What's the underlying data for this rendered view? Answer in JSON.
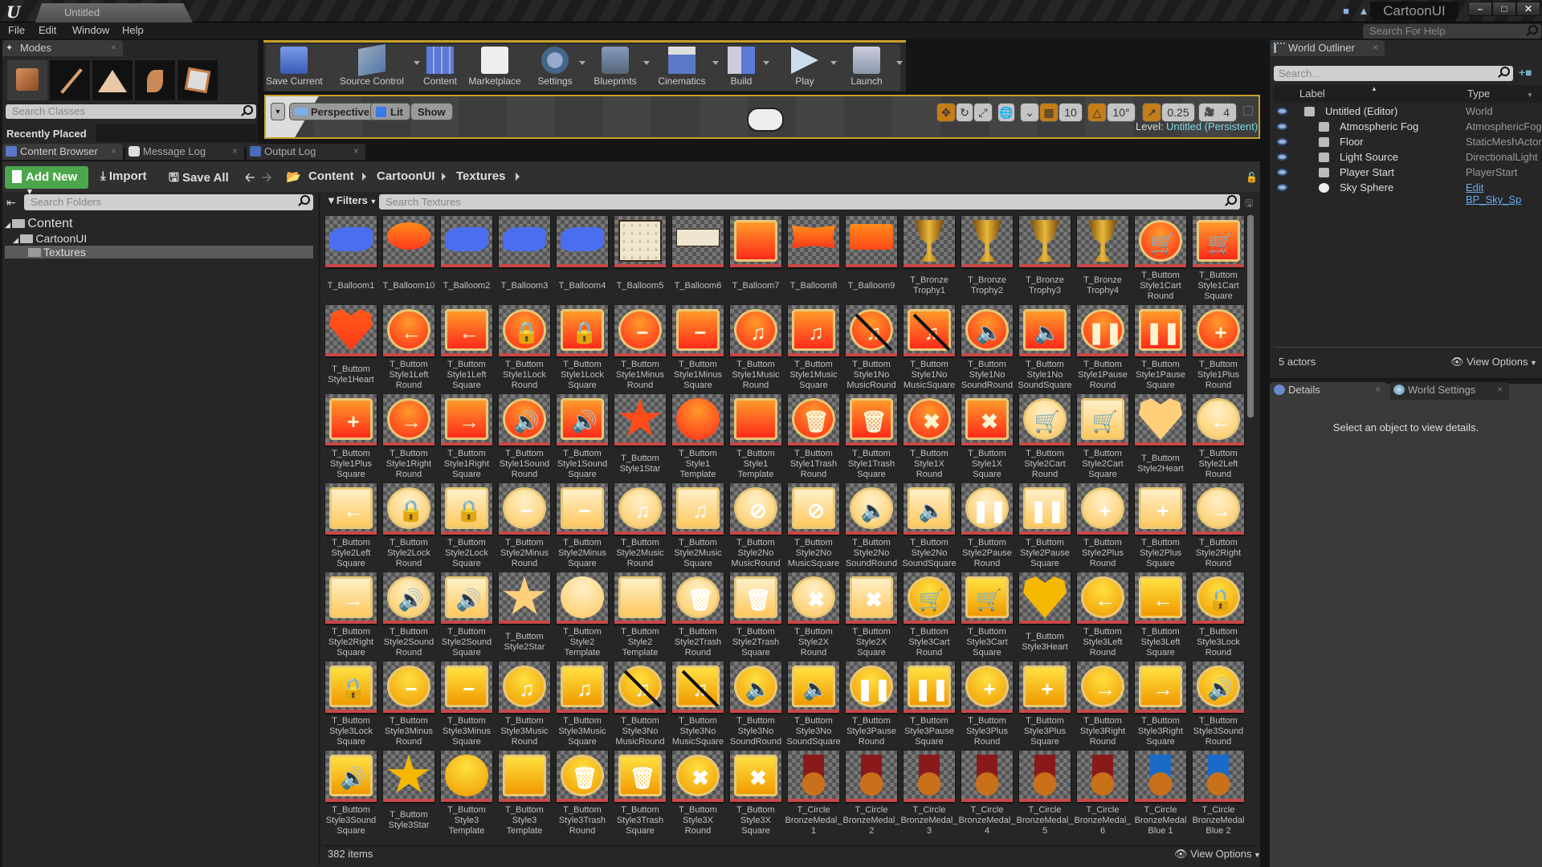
{
  "window": {
    "doc_tab": "Untitled",
    "project_name": "CartoonUI",
    "controls": {
      "minimize": "–",
      "maximize": "□",
      "close": "✕"
    }
  },
  "menu": [
    "File",
    "Edit",
    "Window",
    "Help"
  ],
  "help_search": {
    "placeholder": "Search For Help"
  },
  "modes": {
    "tab_label": "Modes",
    "mode_icons": [
      "place-mode-icon",
      "paint-mode-icon",
      "landscape-mode-icon",
      "foliage-mode-icon",
      "geometry-mode-icon"
    ],
    "search_placeholder": "Search Classes",
    "recently_placed": "Recently Placed"
  },
  "toolbar": {
    "buttons": [
      {
        "label": "Save Current",
        "icon": "save-icon",
        "dropdown": false
      },
      {
        "label": "Source Control",
        "icon": "source-control-icon",
        "dropdown": true
      },
      {
        "label": "Content",
        "icon": "content-icon",
        "dropdown": false
      },
      {
        "label": "Marketplace",
        "icon": "marketplace-icon",
        "dropdown": false
      },
      {
        "label": "Settings",
        "icon": "settings-icon",
        "dropdown": true
      },
      {
        "label": "Blueprints",
        "icon": "blueprints-icon",
        "dropdown": true
      },
      {
        "label": "Cinematics",
        "icon": "cinematics-icon",
        "dropdown": true
      },
      {
        "label": "Build",
        "icon": "build-icon",
        "dropdown": true
      },
      {
        "label": "Play",
        "icon": "play-icon",
        "dropdown": true
      },
      {
        "label": "Launch",
        "icon": "launch-icon",
        "dropdown": true
      }
    ]
  },
  "viewport": {
    "perspective": "Perspective",
    "lit": "Lit",
    "show": "Show",
    "grid_snap": "10",
    "rotation_snap": "10°",
    "scale_snap": "0.25",
    "camera_speed": "4",
    "level_label": "Level:",
    "level_value": "Untitled (Persistent)"
  },
  "bottom_tabs": [
    {
      "label": "Content Browser",
      "active": true
    },
    {
      "label": "Message Log",
      "active": false
    },
    {
      "label": "Output Log",
      "active": false
    }
  ],
  "content_browser": {
    "add_new": "Add New",
    "import": "Import",
    "save_all": "Save All",
    "breadcrumb": [
      "Content",
      "CartoonUI",
      "Textures"
    ],
    "folder_search_placeholder": "Search Folders",
    "tree": [
      {
        "label": "Content",
        "level": 0
      },
      {
        "label": "CartoonUI",
        "level": 1
      },
      {
        "label": "Textures",
        "level": 2,
        "selected": true
      }
    ],
    "filters_label": "Filters",
    "search_placeholder": "Search Textures",
    "item_count": "382 items",
    "view_options": "View Options",
    "assets": [
      {
        "name": "T_Balloom1",
        "shape": "blob",
        "color": "#4a6ef0"
      },
      {
        "name": "T_Balloom10",
        "shape": "speech",
        "color": "#ff6a1a"
      },
      {
        "name": "T_Balloom2",
        "shape": "blob",
        "color": "#4a6ef0"
      },
      {
        "name": "T_Balloom3",
        "shape": "blob",
        "color": "#4a6ef0"
      },
      {
        "name": "T_Balloom4",
        "shape": "blob",
        "color": "#4a6ef0"
      },
      {
        "name": "T_Balloom5",
        "shape": "paper",
        "color": "#efe6d0"
      },
      {
        "name": "T_Balloom6",
        "shape": "paperthin",
        "color": "#efe6d0"
      },
      {
        "name": "T_Balloom7",
        "shape": "square",
        "color": "#ff4a1a"
      },
      {
        "name": "T_Balloom8",
        "shape": "banner",
        "color": "#ff5a1a"
      },
      {
        "name": "T_Balloom9",
        "shape": "speechsq",
        "color": "#ff6a1a"
      },
      {
        "name": "T_Bronze\nTrophy1",
        "shape": "trophy",
        "color": "#c8901a"
      },
      {
        "name": "T_Bronze\nTrophy2",
        "shape": "trophy",
        "color": "#c8901a"
      },
      {
        "name": "T_Bronze\nTrophy3",
        "shape": "trophy",
        "color": "#c8901a"
      },
      {
        "name": "T_Bronze\nTrophy4",
        "shape": "trophy",
        "color": "#c8901a"
      },
      {
        "name": "T_Buttom\nStyle1Cart\nRound",
        "shape": "round",
        "color": "#ff4a1a",
        "glyph": "🛒"
      },
      {
        "name": "T_Buttom\nStyle1Cart\nSquare",
        "shape": "square",
        "color": "#ff4a1a",
        "glyph": "🛒"
      },
      {
        "name": "T_Buttom\nStyle1Heart",
        "shape": "heart",
        "color": "#ff5a1a"
      },
      {
        "name": "T_Buttom\nStyle1Left\nRound",
        "shape": "round",
        "color": "#ff4a1a",
        "glyph": "←"
      },
      {
        "name": "T_Buttom\nStyle1Left\nSquare",
        "shape": "square",
        "color": "#ff4a1a",
        "glyph": "←"
      },
      {
        "name": "T_Buttom\nStyle1Lock\nRound",
        "shape": "round",
        "color": "#ff4a1a",
        "glyph": "🔒"
      },
      {
        "name": "T_Buttom\nStyle1Lock\nSquare",
        "shape": "square",
        "color": "#ff4a1a",
        "glyph": "🔒"
      },
      {
        "name": "T_Buttom\nStyle1Minus\nRound",
        "shape": "round",
        "color": "#ff4a1a",
        "glyph": "−"
      },
      {
        "name": "T_Buttom\nStyle1Minus\nSquare",
        "shape": "square",
        "color": "#ff4a1a",
        "glyph": "−"
      },
      {
        "name": "T_Buttom\nStyle1Music\nRound",
        "shape": "round",
        "color": "#ff4a1a",
        "glyph": "♫"
      },
      {
        "name": "T_Buttom\nStyle1Music\nSquare",
        "shape": "square",
        "color": "#ff4a1a",
        "glyph": "♫"
      },
      {
        "name": "T_Buttom\nStyle1No\nMusicRound",
        "shape": "round",
        "color": "#ff4a1a",
        "glyph": "♫",
        "slash": true
      },
      {
        "name": "T_Buttom\nStyle1No\nMusicSquare",
        "shape": "square",
        "color": "#ff4a1a",
        "glyph": "♫",
        "slash": true
      },
      {
        "name": "T_Buttom\nStyle1No\nSoundRound",
        "shape": "round",
        "color": "#ff4a1a",
        "glyph": "🔈"
      },
      {
        "name": "T_Buttom\nStyle1No\nSoundSquare",
        "shape": "square",
        "color": "#ff4a1a",
        "glyph": "🔈"
      },
      {
        "name": "T_Buttom\nStyle1Pause\nRound",
        "shape": "round",
        "color": "#ff4a1a",
        "glyph": "❚❚"
      },
      {
        "name": "T_Buttom\nStyle1Pause\nSquare",
        "shape": "square",
        "color": "#ff4a1a",
        "glyph": "❚❚"
      },
      {
        "name": "T_Buttom\nStyle1Plus\nRound",
        "shape": "round",
        "color": "#ff4a1a",
        "glyph": "+"
      },
      {
        "name": "T_Buttom\nStyle1Plus\nSquare",
        "shape": "square",
        "color": "#ff4a1a",
        "glyph": "+"
      },
      {
        "name": "T_Buttom\nStyle1Right\nRound",
        "shape": "round",
        "color": "#ff4a1a",
        "glyph": "→"
      },
      {
        "name": "T_Buttom\nStyle1Right\nSquare",
        "shape": "square",
        "color": "#ff4a1a",
        "glyph": "→"
      },
      {
        "name": "T_Buttom\nStyle1Sound\nRound",
        "shape": "round",
        "color": "#ff4a1a",
        "glyph": "🔊"
      },
      {
        "name": "T_Buttom\nStyle1Sound\nSquare",
        "shape": "square",
        "color": "#ff4a1a",
        "glyph": "🔊"
      },
      {
        "name": "T_Buttom\nStyle1Star",
        "shape": "star",
        "color": "#ff4a1a"
      },
      {
        "name": "T_Buttom\nStyle1\nTemplate",
        "shape": "circle",
        "color": "#ff4a1a"
      },
      {
        "name": "T_Buttom\nStyle1\nTemplate",
        "shape": "square",
        "color": "#ff4a1a"
      },
      {
        "name": "T_Buttom\nStyle1Trash\nRound",
        "shape": "round",
        "color": "#ff4a1a",
        "glyph": "🗑"
      },
      {
        "name": "T_Buttom\nStyle1Trash\nSquare",
        "shape": "square",
        "color": "#ff4a1a",
        "glyph": "🗑"
      },
      {
        "name": "T_Buttom\nStyle1X\nRound",
        "shape": "round",
        "color": "#ff4a1a",
        "glyph": "✖"
      },
      {
        "name": "T_Buttom\nStyle1X\nSquare",
        "shape": "square",
        "color": "#ff4a1a",
        "glyph": "✖"
      },
      {
        "name": "T_Buttom\nStyle2Cart\nRound",
        "shape": "round",
        "color": "#ffcf7a",
        "glyph": "🛒"
      },
      {
        "name": "T_Buttom\nStyle2Cart\nSquare",
        "shape": "square",
        "color": "#ffcf7a",
        "glyph": "🛒"
      },
      {
        "name": "T_Buttom\nStyle2Heart",
        "shape": "heart",
        "color": "#ffcf7a"
      },
      {
        "name": "T_Buttom\nStyle2Left\nRound",
        "shape": "round",
        "color": "#ffcf7a",
        "glyph": "←"
      },
      {
        "name": "T_Buttom\nStyle2Left\nSquare",
        "shape": "square",
        "color": "#ffcf7a",
        "glyph": "←"
      },
      {
        "name": "T_Buttom\nStyle2Lock\nRound",
        "shape": "round",
        "color": "#ffcf7a",
        "glyph": "🔒"
      },
      {
        "name": "T_Buttom\nStyle2Lock\nSquare",
        "shape": "square",
        "color": "#ffcf7a",
        "glyph": "🔒"
      },
      {
        "name": "T_Buttom\nStyle2Minus\nRound",
        "shape": "round",
        "color": "#ffcf7a",
        "glyph": "−"
      },
      {
        "name": "T_Buttom\nStyle2Minus\nSquare",
        "shape": "square",
        "color": "#ffcf7a",
        "glyph": "−"
      },
      {
        "name": "T_Buttom\nStyle2Music\nRound",
        "shape": "round",
        "color": "#ffcf7a",
        "glyph": "♫"
      },
      {
        "name": "T_Buttom\nStyle2Music\nSquare",
        "shape": "square",
        "color": "#ffcf7a",
        "glyph": "♫"
      },
      {
        "name": "T_Buttom\nStyle2No\nMusicRound",
        "shape": "round",
        "color": "#ffcf7a",
        "glyph": "⊘"
      },
      {
        "name": "T_Buttom\nStyle2No\nMusicSquare",
        "shape": "square",
        "color": "#ffcf7a",
        "glyph": "⊘"
      },
      {
        "name": "T_Buttom\nStyle2No\nSoundRound",
        "shape": "round",
        "color": "#ffcf7a",
        "glyph": "🔈"
      },
      {
        "name": "T_Buttom\nStyle2No\nSoundSquare",
        "shape": "square",
        "color": "#ffcf7a",
        "glyph": "🔈"
      },
      {
        "name": "T_Buttom\nStyle2Pause\nRound",
        "shape": "round",
        "color": "#ffcf7a",
        "glyph": "❚❚"
      },
      {
        "name": "T_Buttom\nStyle2Pause\nSquare",
        "shape": "square",
        "color": "#ffcf7a",
        "glyph": "❚❚"
      },
      {
        "name": "T_Buttom\nStyle2Plus\nRound",
        "shape": "round",
        "color": "#ffcf7a",
        "glyph": "+"
      },
      {
        "name": "T_Buttom\nStyle2Plus\nSquare",
        "shape": "square",
        "color": "#ffcf7a",
        "glyph": "+"
      },
      {
        "name": "T_Buttom\nStyle2Right\nRound",
        "shape": "round",
        "color": "#ffcf7a",
        "glyph": "→"
      },
      {
        "name": "T_Buttom\nStyle2Right\nSquare",
        "shape": "square",
        "color": "#ffcf7a",
        "glyph": "→"
      },
      {
        "name": "T_Buttom\nStyle2Sound\nRound",
        "shape": "round",
        "color": "#ffcf7a",
        "glyph": "🔊"
      },
      {
        "name": "T_Buttom\nStyle2Sound\nSquare",
        "shape": "square",
        "color": "#ffcf7a",
        "glyph": "🔊"
      },
      {
        "name": "T_Buttom\nStyle2Star",
        "shape": "star",
        "color": "#ffcf7a"
      },
      {
        "name": "T_Buttom\nStyle2\nTemplate",
        "shape": "circle",
        "color": "#ffcf7a"
      },
      {
        "name": "T_Buttom\nStyle2\nTemplate",
        "shape": "square",
        "color": "#ffcf7a"
      },
      {
        "name": "T_Buttom\nStyle2Trash\nRound",
        "shape": "round",
        "color": "#ffcf7a",
        "glyph": "🗑"
      },
      {
        "name": "T_Buttom\nStyle2Trash\nSquare",
        "shape": "square",
        "color": "#ffcf7a",
        "glyph": "🗑"
      },
      {
        "name": "T_Buttom\nStyle2X\nRound",
        "shape": "round",
        "color": "#ffcf7a",
        "glyph": "✖"
      },
      {
        "name": "T_Buttom\nStyle2X\nSquare",
        "shape": "square",
        "color": "#ffcf7a",
        "glyph": "✖"
      },
      {
        "name": "T_Buttom\nStyle3Cart\nRound",
        "shape": "round",
        "color": "#f5b800",
        "glyph": "🛒"
      },
      {
        "name": "T_Buttom\nStyle3Cart\nSquare",
        "shape": "square",
        "color": "#f5b800",
        "glyph": "🛒"
      },
      {
        "name": "T_Buttom\nStyle3Heart",
        "shape": "heart",
        "color": "#f5b800"
      },
      {
        "name": "T_Buttom\nStyle3Left\nRound",
        "shape": "round",
        "color": "#f5b800",
        "glyph": "←"
      },
      {
        "name": "T_Buttom\nStyle3Left\nSquare",
        "shape": "square",
        "color": "#f5b800",
        "glyph": "←"
      },
      {
        "name": "T_Buttom\nStyle3Lock\nRound",
        "shape": "round",
        "color": "#f5b800",
        "glyph": "🔒"
      },
      {
        "name": "T_Buttom\nStyle3Lock\nSquare",
        "shape": "square",
        "color": "#f5b800",
        "glyph": "🔒"
      },
      {
        "name": "T_Buttom\nStyle3Minus\nRound",
        "shape": "round",
        "color": "#f5b800",
        "glyph": "−"
      },
      {
        "name": "T_Buttom\nStyle3Minus\nSquare",
        "shape": "square",
        "color": "#f5b800",
        "glyph": "−"
      },
      {
        "name": "T_Buttom\nStyle3Music\nRound",
        "shape": "round",
        "color": "#f5b800",
        "glyph": "♫"
      },
      {
        "name": "T_Buttom\nStyle3Music\nSquare",
        "shape": "square",
        "color": "#f5b800",
        "glyph": "♫"
      },
      {
        "name": "T_Buttom\nStyle3No\nMusicRound",
        "shape": "round",
        "color": "#f5b800",
        "glyph": "♫",
        "slash": true
      },
      {
        "name": "T_Buttom\nStyle3No\nMusicSquare",
        "shape": "square",
        "color": "#f5b800",
        "glyph": "♫",
        "slash": true
      },
      {
        "name": "T_Buttom\nStyle3No\nSoundRound",
        "shape": "round",
        "color": "#f5b800",
        "glyph": "🔈"
      },
      {
        "name": "T_Buttom\nStyle3No\nSoundSquare",
        "shape": "square",
        "color": "#f5b800",
        "glyph": "🔈"
      },
      {
        "name": "T_Buttom\nStyle3Pause\nRound",
        "shape": "round",
        "color": "#f5b800",
        "glyph": "❚❚"
      },
      {
        "name": "T_Buttom\nStyle3Pause\nSquare",
        "shape": "square",
        "color": "#f5b800",
        "glyph": "❚❚"
      },
      {
        "name": "T_Buttom\nStyle3Plus\nRound",
        "shape": "round",
        "color": "#f5b800",
        "glyph": "+"
      },
      {
        "name": "T_Buttom\nStyle3Plus\nSquare",
        "shape": "square",
        "color": "#f5b800",
        "glyph": "+"
      },
      {
        "name": "T_Buttom\nStyle3Right\nRound",
        "shape": "round",
        "color": "#f5b800",
        "glyph": "→"
      },
      {
        "name": "T_Buttom\nStyle3Right\nSquare",
        "shape": "square",
        "color": "#f5b800",
        "glyph": "→"
      },
      {
        "name": "T_Buttom\nStyle3Sound\nRound",
        "shape": "round",
        "color": "#f5b800",
        "glyph": "🔊"
      },
      {
        "name": "T_Buttom\nStyle3Sound\nSquare",
        "shape": "square",
        "color": "#f5b800",
        "glyph": "🔊"
      },
      {
        "name": "T_Buttom\nStyle3Star",
        "shape": "star",
        "color": "#f5b800"
      },
      {
        "name": "T_Buttom\nStyle3\nTemplate",
        "shape": "circle",
        "color": "#f5b800"
      },
      {
        "name": "T_Buttom\nStyle3\nTemplate",
        "shape": "square",
        "color": "#f5b800"
      },
      {
        "name": "T_Buttom\nStyle3Trash\nRound",
        "shape": "round",
        "color": "#f5b800",
        "glyph": "🗑"
      },
      {
        "name": "T_Buttom\nStyle3Trash\nSquare",
        "shape": "square",
        "color": "#f5b800",
        "glyph": "🗑"
      },
      {
        "name": "T_Buttom\nStyle3X\nRound",
        "shape": "round",
        "color": "#f5b800",
        "glyph": "✖"
      },
      {
        "name": "T_Buttom\nStyle3X\nSquare",
        "shape": "square",
        "color": "#f5b800",
        "glyph": "✖"
      },
      {
        "name": "T_Circle\nBronzeMedal_\n1",
        "shape": "medal",
        "color": "#c8701a",
        "ribbon": "#8a1a1a"
      },
      {
        "name": "T_Circle\nBronzeMedal_\n2",
        "shape": "medal",
        "color": "#c8701a",
        "ribbon": "#8a1a1a"
      },
      {
        "name": "T_Circle\nBronzeMedal_\n3",
        "shape": "medal",
        "color": "#c8701a",
        "ribbon": "#8a1a1a"
      },
      {
        "name": "T_Circle\nBronzeMedal_\n4",
        "shape": "medal",
        "color": "#c8701a",
        "ribbon": "#8a1a1a"
      },
      {
        "name": "T_Circle\nBronzeMedal_\n5",
        "shape": "medal",
        "color": "#c8701a",
        "ribbon": "#8a1a1a"
      },
      {
        "name": "T_Circle\nBronzeMedal_\n6",
        "shape": "medal",
        "color": "#c8701a",
        "ribbon": "#8a1a1a"
      },
      {
        "name": "T_Circle\nBronzeMedal\nBlue 1",
        "shape": "medal",
        "color": "#c8701a",
        "ribbon": "#1a6ac8"
      },
      {
        "name": "T_Circle\nBronzeMedal\nBlue 2",
        "shape": "medal",
        "color": "#c8701a",
        "ribbon": "#1a6ac8"
      }
    ]
  },
  "world_outliner": {
    "tab_label": "World Outliner",
    "search_placeholder": "Search...",
    "columns": {
      "label": "Label",
      "type": "Type"
    },
    "rows": [
      {
        "label": "Untitled (Editor)",
        "type": "World",
        "indent": 0,
        "icon": "world-icon"
      },
      {
        "label": "Atmospheric Fog",
        "type": "AtmosphericFog",
        "indent": 1,
        "icon": "fog-icon"
      },
      {
        "label": "Floor",
        "type": "StaticMeshActor",
        "indent": 1,
        "icon": "mesh-icon"
      },
      {
        "label": "Light Source",
        "type": "DirectionalLight",
        "indent": 1,
        "icon": "light-icon"
      },
      {
        "label": "Player Start",
        "type": "PlayerStart",
        "indent": 1,
        "icon": "player-start-icon"
      },
      {
        "label": "Sky Sphere",
        "type": "Edit BP_Sky_Sp",
        "indent": 1,
        "icon": "sphere-icon",
        "type_link": true
      }
    ],
    "actor_count": "5 actors",
    "view_options": "View Options"
  },
  "details": {
    "tabs": [
      {
        "label": "Details",
        "active": true
      },
      {
        "label": "World Settings",
        "active": false
      }
    ],
    "empty_message": "Select an object to view details."
  }
}
